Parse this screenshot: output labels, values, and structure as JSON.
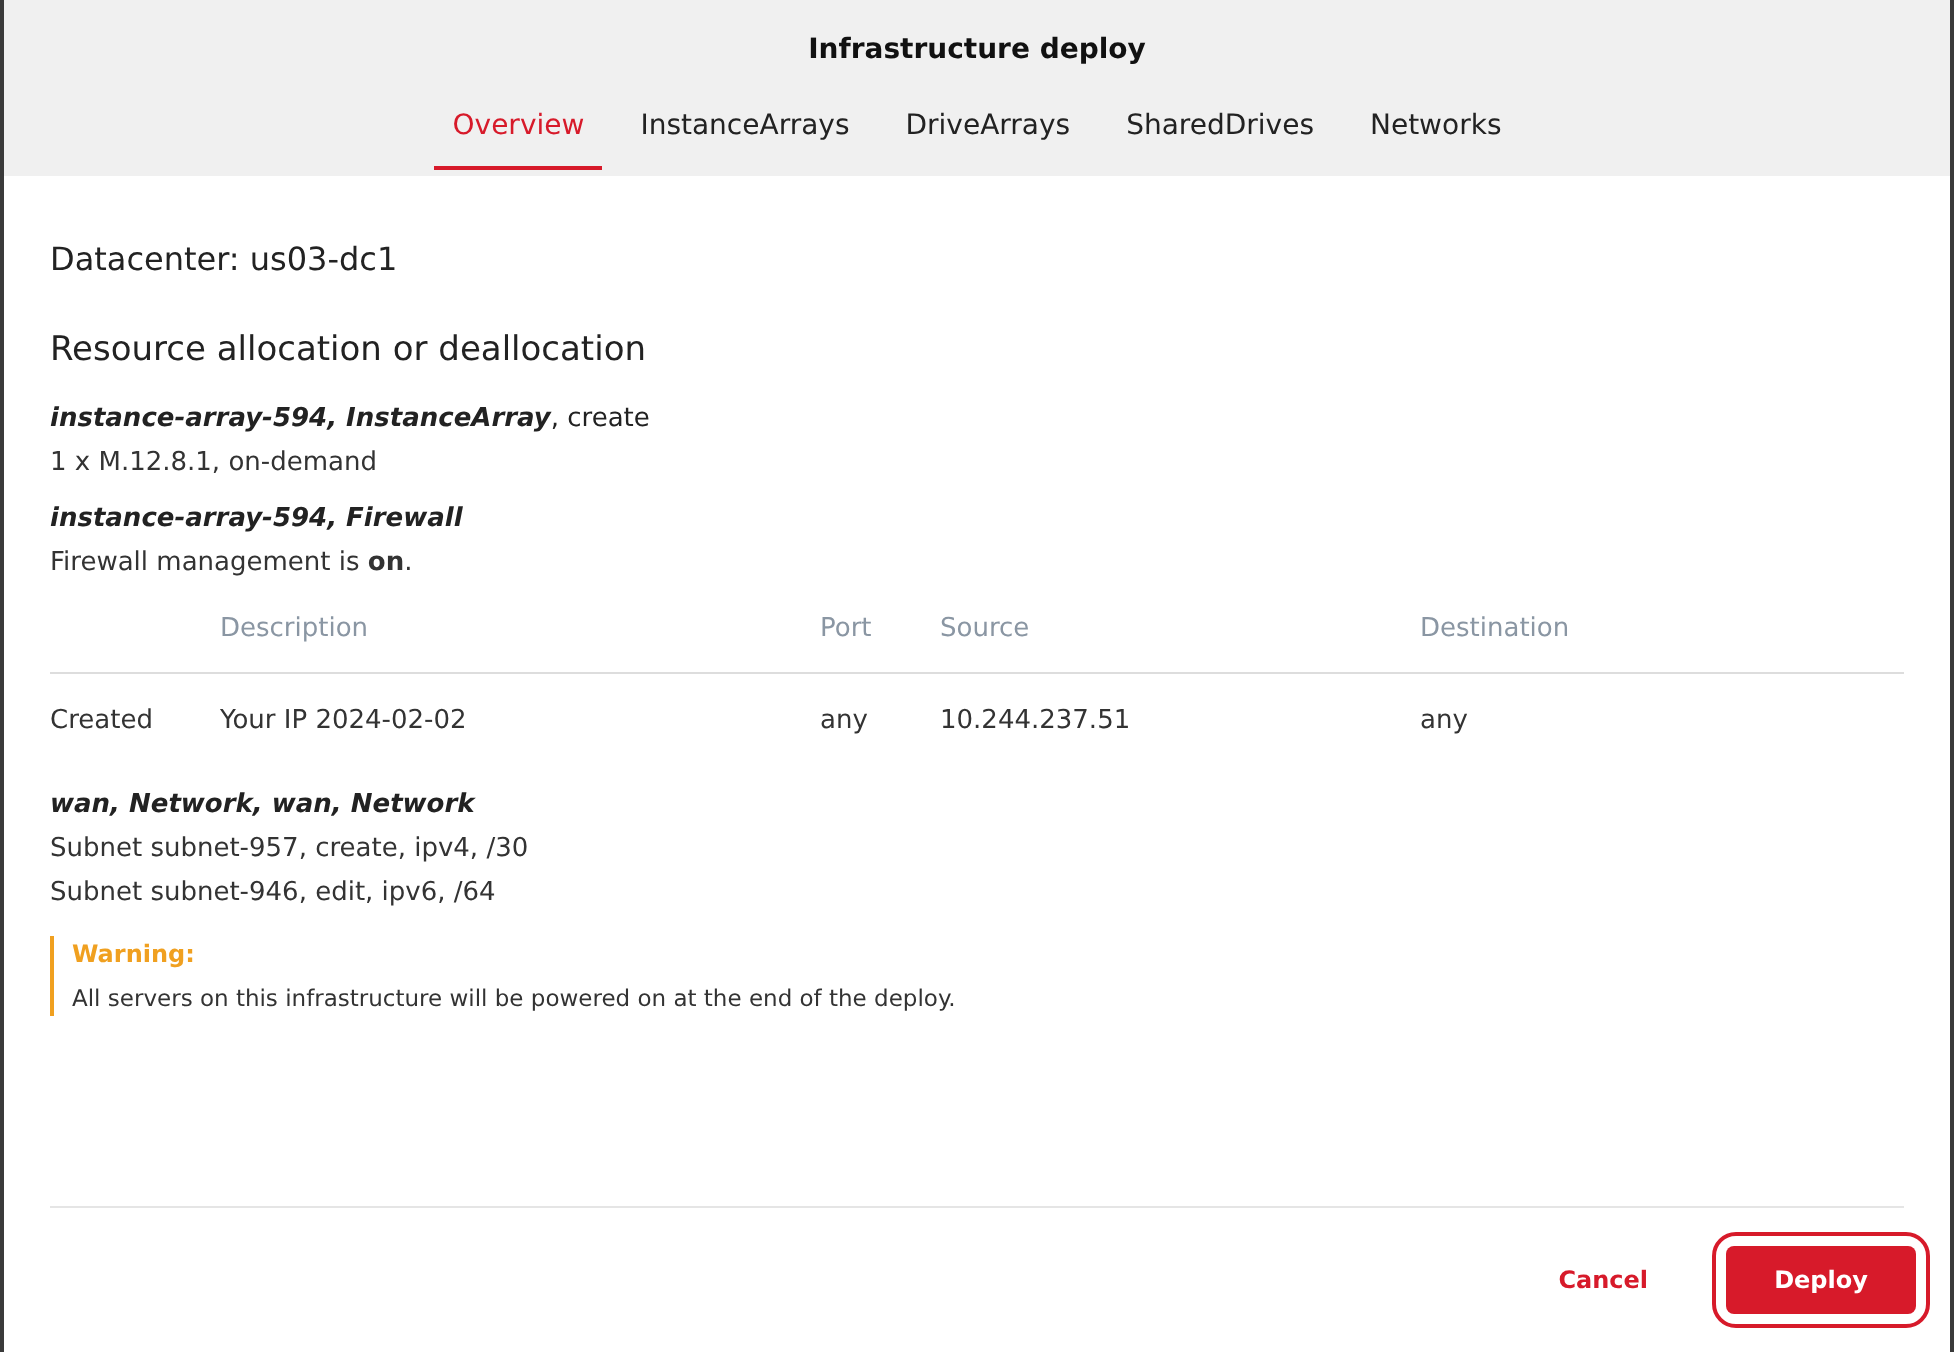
{
  "dialog": {
    "title": "Infrastructure deploy"
  },
  "tabs": [
    {
      "label": "Overview",
      "selected": true
    },
    {
      "label": "InstanceArrays",
      "selected": false
    },
    {
      "label": "DriveArrays",
      "selected": false
    },
    {
      "label": "SharedDrives",
      "selected": false
    },
    {
      "label": "Networks",
      "selected": false
    }
  ],
  "datacenter": "Datacenter: us03-dc1",
  "section_title": "Resource allocation or deallocation",
  "blocks": [
    {
      "kind": "text",
      "heading": "**instance-array-594, InstanceArray**, create",
      "lines": [
        "1 x M.12.8.1, on-demand"
      ]
    },
    {
      "kind": "text",
      "heading": "**instance-array-594, Firewall**",
      "lines": [
        "Firewall management is **on**."
      ]
    },
    {
      "kind": "table",
      "columns": [
        "",
        "Description",
        "Port",
        "Source",
        "Destination"
      ],
      "rows": [
        [
          "Created",
          "Your IP 2024-02-02",
          "any",
          "10.244.237.51",
          "any"
        ]
      ]
    },
    {
      "kind": "text",
      "heading": "**wan, Network, wan, Network**",
      "lines": [
        "Subnet subnet-957, create, ipv4, /30",
        "Subnet subnet-946, edit, ipv6, /64"
      ]
    }
  ],
  "warning": {
    "title": "Warning:",
    "text": "All servers on this infrastructure will be powered on at the end of the deploy."
  },
  "buttons": {
    "cancel": "Cancel",
    "deploy": "Deploy",
    "deploy_highlighted": true
  }
}
